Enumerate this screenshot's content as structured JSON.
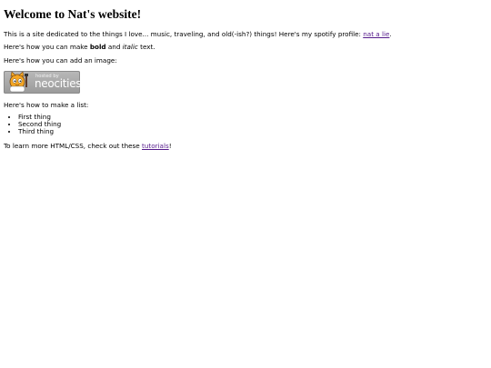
{
  "page": {
    "title": "Welcome to Nat's website!",
    "intro": {
      "text": "This is a site dedicated to the things I love... music, traveling, and old(-ish?) things! Here's my spotify profile: ",
      "link_text": "nat a lie",
      "suffix": "."
    },
    "format_line": {
      "prefix": "Here's how you can make ",
      "bold": "bold",
      "middle": " and ",
      "italic": "italic",
      "suffix": " text."
    },
    "image_line": "Here's how you can add an image:",
    "badge": {
      "hosted_text": "hosted by",
      "brand_text": "neocities"
    },
    "list_intro": "Here's how to make a list:",
    "list_items": [
      "First thing",
      "Second thing",
      "Third thing"
    ],
    "outro": {
      "prefix": "To learn more HTML/CSS, check out these ",
      "link_text": "tutorials",
      "suffix": "!"
    }
  },
  "colors": {
    "link": "#551a8b",
    "text": "#000000",
    "background": "#ffffff"
  }
}
